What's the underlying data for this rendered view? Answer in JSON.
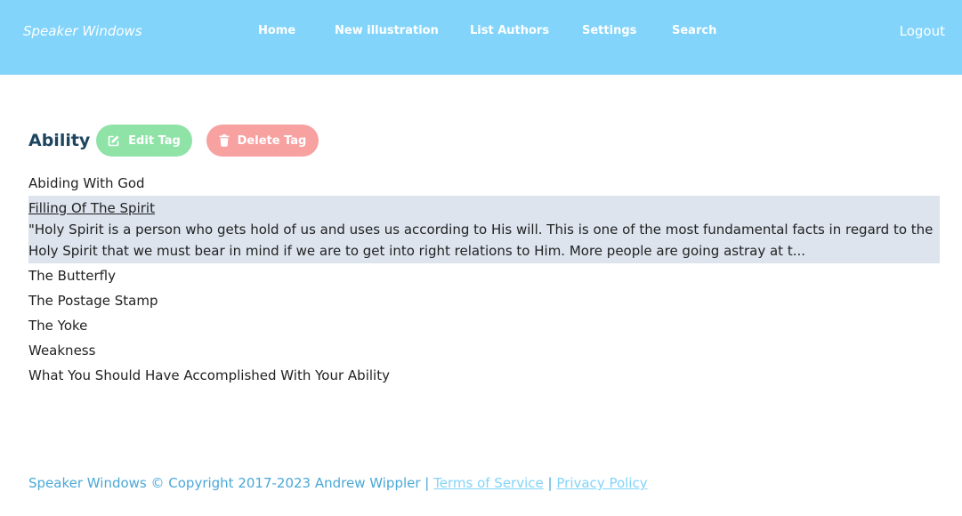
{
  "nav": {
    "brand": "Speaker Windows",
    "links": [
      "Home",
      "New illustration",
      "List Authors",
      "Settings",
      "Search"
    ],
    "logout": "Logout"
  },
  "tag": {
    "title": "Ability",
    "edit_label": "Edit Tag",
    "delete_label": "Delete Tag"
  },
  "illustrations": [
    {
      "title": "Abiding With God"
    },
    {
      "title": "Filling Of The Spirit",
      "excerpt": "\"Holy Spirit is a person who gets hold of us and uses us according to His will. This is one of the most fundamental facts in regard to the Holy Spirit that we must bear in mind if we are to get into right relations to Him. More people are going astray at t..."
    },
    {
      "title": "The Butterfly"
    },
    {
      "title": "The Postage Stamp"
    },
    {
      "title": "The Yoke"
    },
    {
      "title": "Weakness"
    },
    {
      "title": "What You Should Have Accomplished With Your Ability"
    }
  ],
  "footer": {
    "copyright": "Speaker Windows © Copyright 2017-2023 Andrew Wippler |",
    "terms": "Terms of Service",
    "separator": "|",
    "privacy": "Privacy Policy"
  },
  "colors": {
    "navbar": "#82d4fa",
    "edit_button": "#8fe3a7",
    "delete_button": "#f7a1a1",
    "active_row": "#dde4ee",
    "title": "#1d4560"
  },
  "icons": {
    "edit": "pencil-square-icon",
    "delete": "trash-icon"
  }
}
